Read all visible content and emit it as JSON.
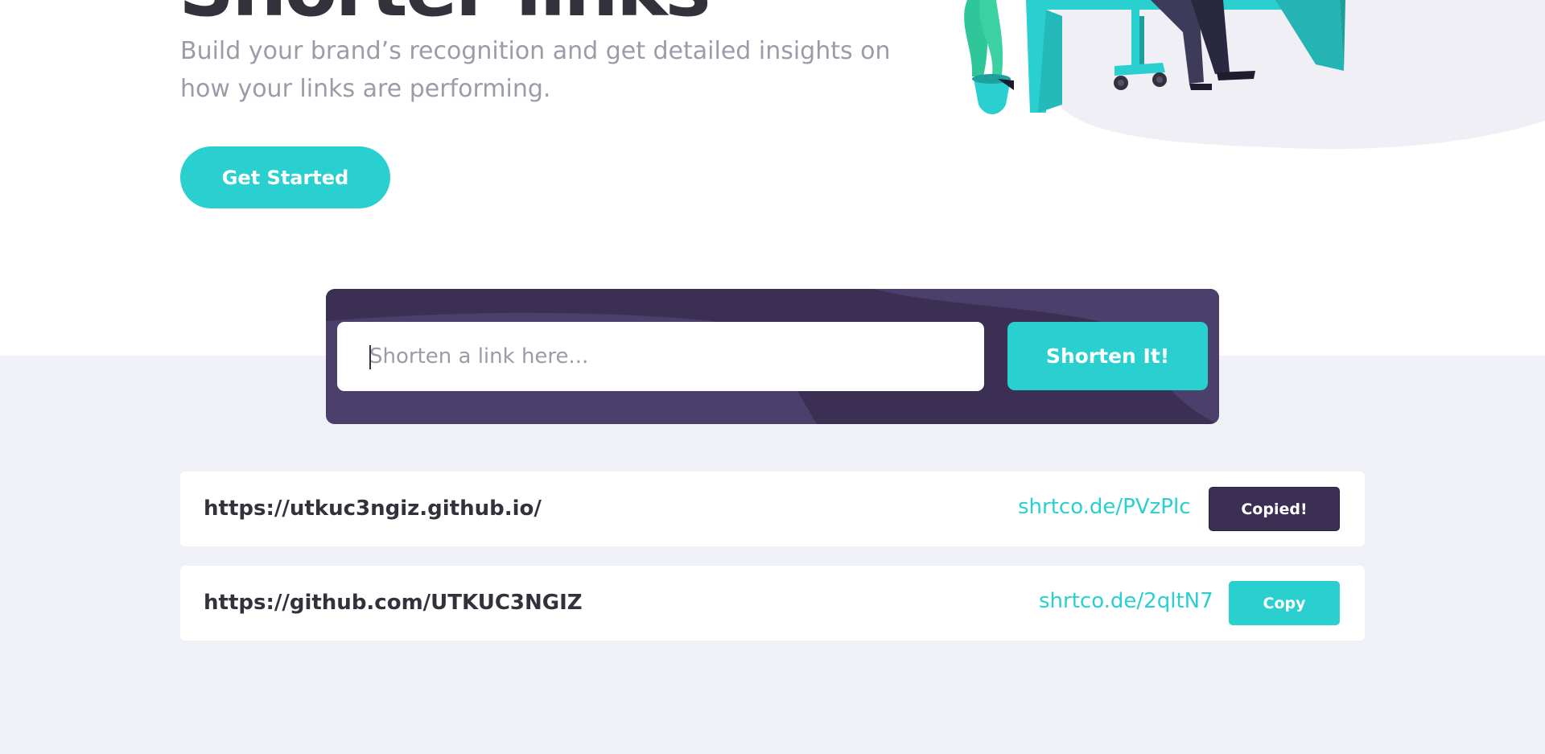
{
  "hero": {
    "title": "Shorter links",
    "subtitle": "Build your brand’s recognition and get detailed insights on how your links are performing.",
    "cta_label": "Get Started"
  },
  "shortener": {
    "placeholder": "Shorten a link here...",
    "button_label": "Shorten It!"
  },
  "results": [
    {
      "original": "https://utkuc3ngiz.github.io/",
      "short": "shrtco.de/PVzPlc",
      "button": "Copied!",
      "state": "copied"
    },
    {
      "original": "https://github.com/UTKUC3NGIZ",
      "short": "shrtco.de/2qltN7",
      "button": "Copy",
      "state": "idle"
    }
  ],
  "colors": {
    "cyan": "#2acfcf",
    "dark_violet": "#3b3054",
    "dark_text": "#34313d",
    "gray_text": "#9e9aa8",
    "light_bg": "#f0f1f6"
  }
}
